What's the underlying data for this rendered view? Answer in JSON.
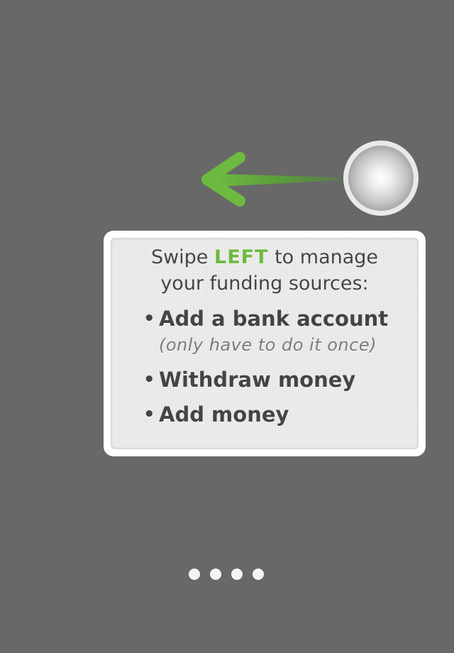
{
  "colors": {
    "background": "#686868",
    "accent_green": "#6dba3e",
    "card_text": "#444444",
    "card_background": "#e9e9e9"
  },
  "gesture": {
    "arrow_icon": "arrow-left-icon",
    "touch_icon": "touch-point-icon"
  },
  "tutorial": {
    "headline_prefix": "Swipe ",
    "headline_accent": "LEFT",
    "headline_suffix": " to manage",
    "headline_line2": "your funding sources:",
    "bullet": "•",
    "items": [
      {
        "label": "Add a bank account",
        "note": "(only have to do it once)"
      },
      {
        "label": "Withdraw money"
      },
      {
        "label": "Add money"
      }
    ]
  },
  "pagination": {
    "total_pages": 4
  }
}
